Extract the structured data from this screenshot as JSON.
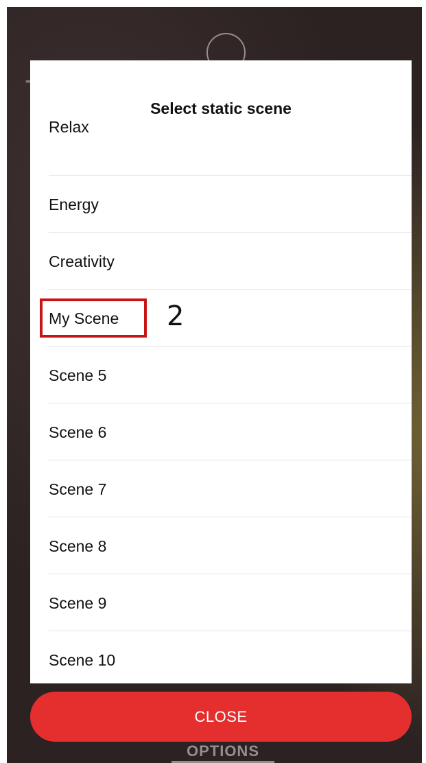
{
  "background": {
    "footer_label": "OPTIONS",
    "icons": [
      "arrow-left-icon",
      "circle-icon"
    ]
  },
  "dialog": {
    "title": "Select static scene",
    "scenes": [
      "Relax",
      "Energy",
      "Creativity",
      "My Scene",
      "Scene 5",
      "Scene 6",
      "Scene 7",
      "Scene 8",
      "Scene 9",
      "Scene 10"
    ],
    "close_label": "CLOSE"
  },
  "annotation": {
    "number": "2",
    "highlight_color": "#c81414"
  },
  "colors": {
    "accent": "#e52f2f",
    "modal_bg": "#ffffff",
    "divider": "#e3e3e3"
  }
}
